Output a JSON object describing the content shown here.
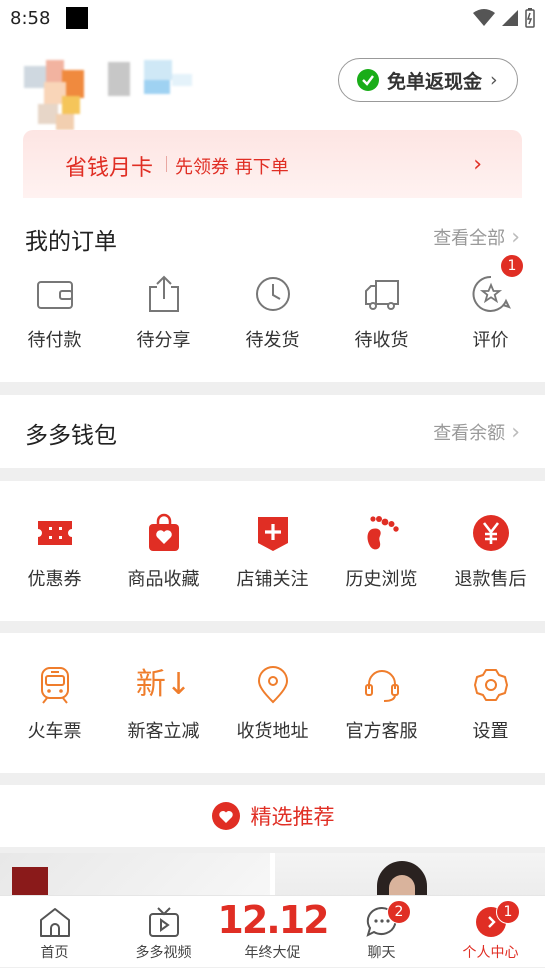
{
  "status_bar": {
    "time": "8:58"
  },
  "header": {
    "cashback_label": "免单返现金"
  },
  "card": {
    "title": "省钱月卡",
    "subtitle": "先领券 再下单"
  },
  "orders": {
    "title": "我的订单",
    "more": "查看全部",
    "items": [
      {
        "label": "待付款",
        "icon": "wallet-icon"
      },
      {
        "label": "待分享",
        "icon": "share-icon"
      },
      {
        "label": "待发货",
        "icon": "clock-icon"
      },
      {
        "label": "待收货",
        "icon": "truck-icon"
      },
      {
        "label": "评价",
        "icon": "review-icon",
        "badge": "1"
      }
    ]
  },
  "wallet": {
    "title": "多多钱包",
    "more": "查看余额"
  },
  "services": {
    "items": [
      {
        "label": "优惠券",
        "icon": "coupon-icon"
      },
      {
        "label": "商品收藏",
        "icon": "favorite-bag-icon"
      },
      {
        "label": "店铺关注",
        "icon": "store-follow-icon"
      },
      {
        "label": "历史浏览",
        "icon": "footprint-icon"
      },
      {
        "label": "退款售后",
        "icon": "refund-icon"
      }
    ],
    "color": "#e02e24"
  },
  "tools": {
    "items": [
      {
        "label": "火车票",
        "icon": "train-icon"
      },
      {
        "label": "新客立减",
        "icon": "new-customer-icon",
        "glyph": "新↓"
      },
      {
        "label": "收货地址",
        "icon": "location-icon"
      },
      {
        "label": "官方客服",
        "icon": "headset-icon"
      },
      {
        "label": "设置",
        "icon": "settings-icon"
      }
    ],
    "color": "#ef7d2c"
  },
  "recommend": {
    "title": "精选推荐"
  },
  "tabbar": {
    "items": [
      {
        "label": "首页",
        "icon": "home-icon"
      },
      {
        "label": "多多视频",
        "icon": "video-icon"
      },
      {
        "label": "年终大促",
        "big": "12.12"
      },
      {
        "label": "聊天",
        "icon": "chat-icon",
        "badge": "2"
      },
      {
        "label": "个人中心",
        "icon": "profile-icon",
        "badge": "1",
        "active": true
      }
    ],
    "active_color": "#e02e24"
  }
}
